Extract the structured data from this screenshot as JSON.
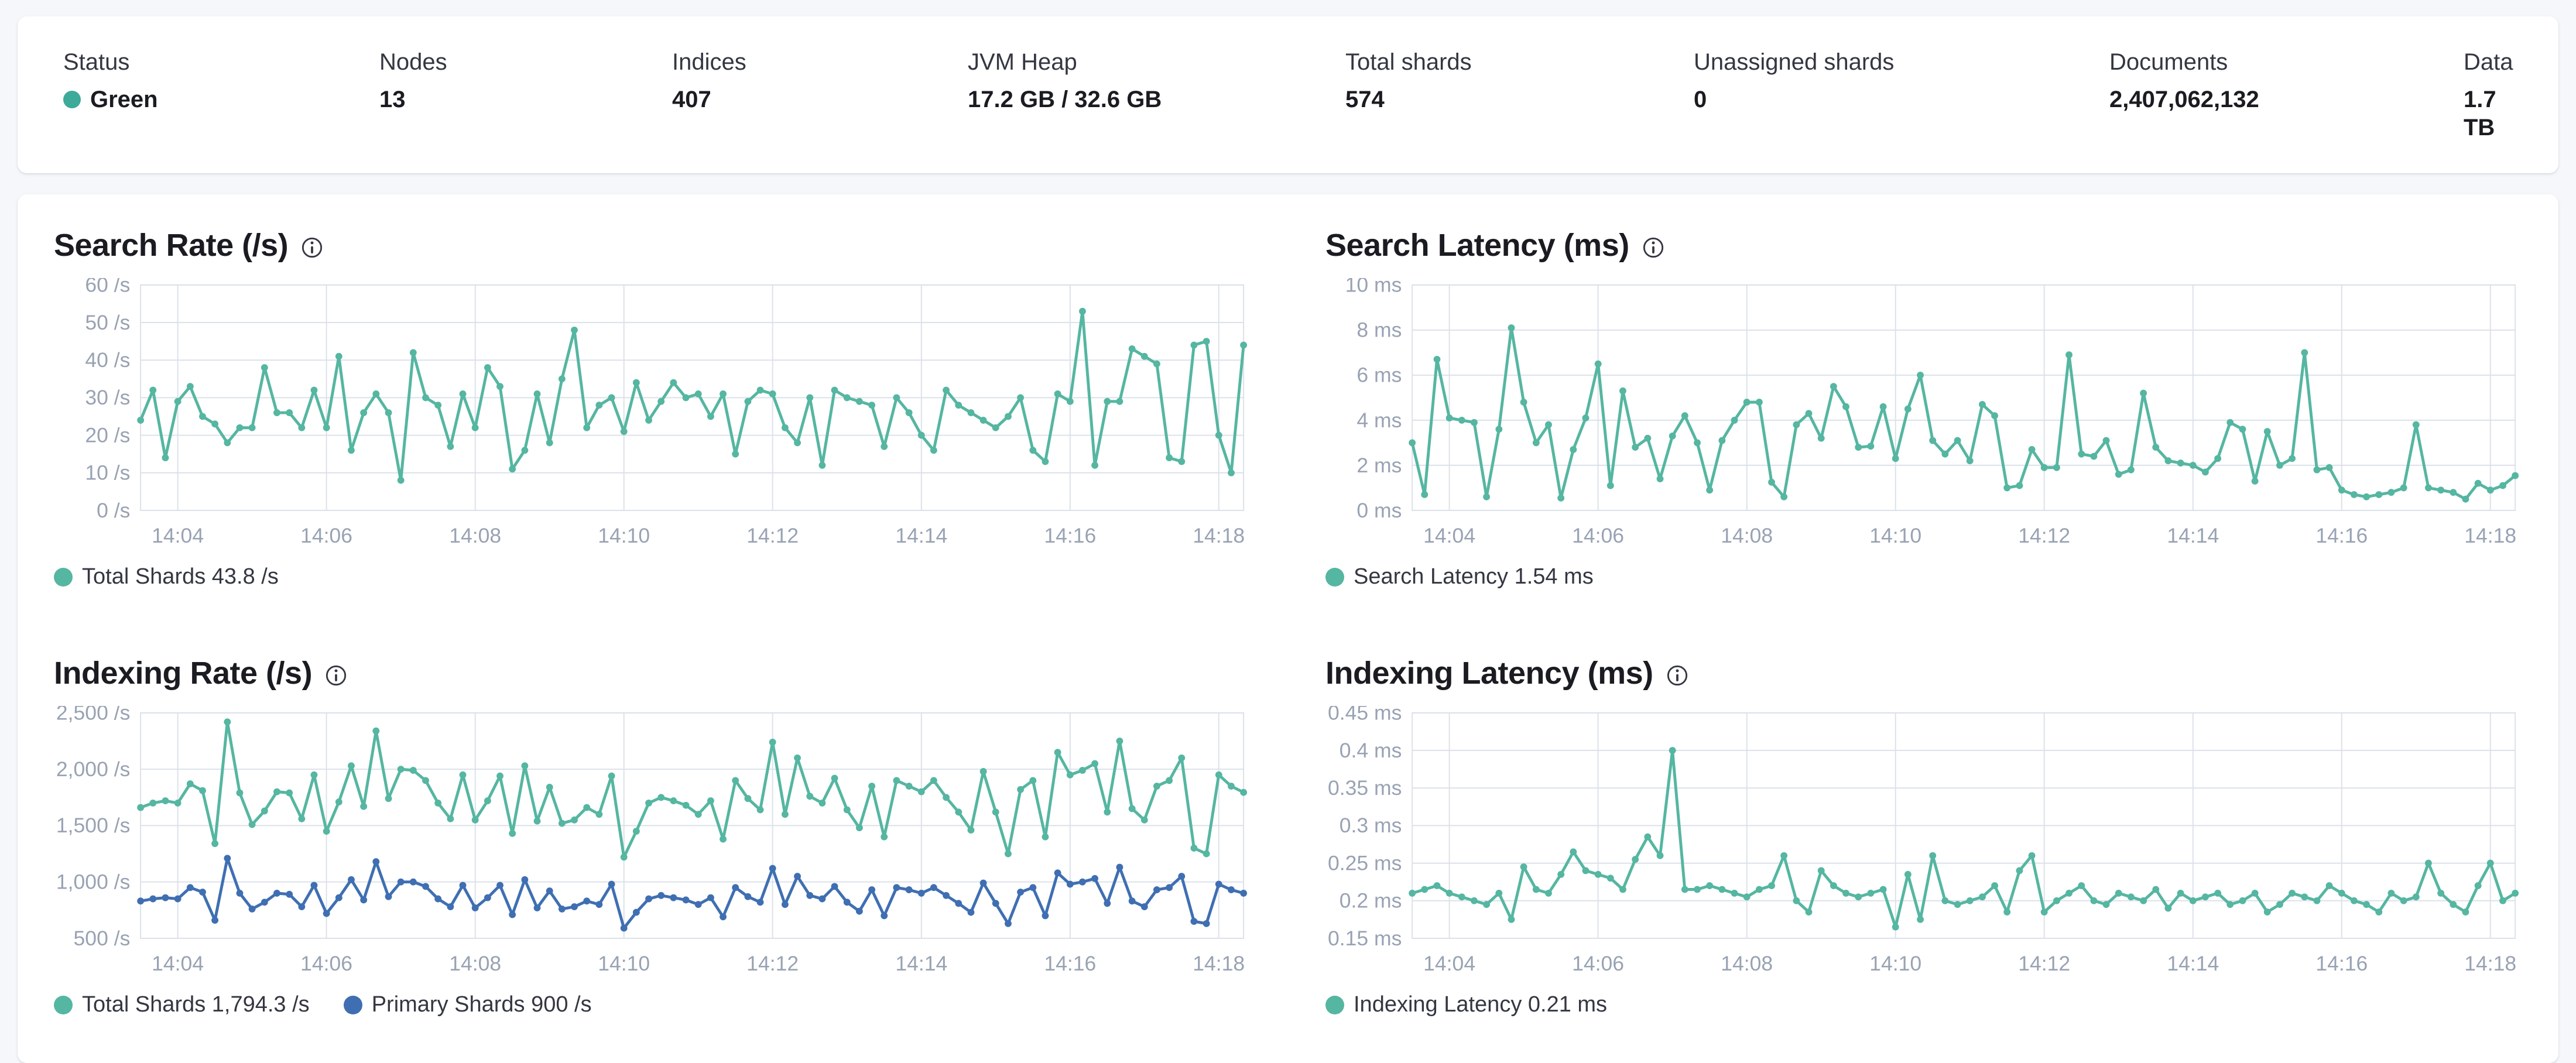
{
  "overview": {
    "status_color": "#3EAA9A",
    "stats": [
      {
        "label": "Status",
        "value": "Green"
      },
      {
        "label": "Nodes",
        "value": "13"
      },
      {
        "label": "Indices",
        "value": "407"
      },
      {
        "label": "JVM Heap",
        "value": "17.2 GB / 32.6 GB"
      },
      {
        "label": "Total shards",
        "value": "574"
      },
      {
        "label": "Unassigned shards",
        "value": "0"
      },
      {
        "label": "Documents",
        "value": "2,407,062,132"
      },
      {
        "label": "Data",
        "value": "1.7 TB"
      }
    ]
  },
  "chart_data": [
    {
      "type": "line",
      "title": "Search Rate (/s)",
      "ylabel": "/s",
      "ylim": [
        0,
        60
      ],
      "grid": true,
      "legend_position": "bottom",
      "yticks": [
        {
          "v": 60,
          "label": "60 /s"
        },
        {
          "v": 50,
          "label": "50 /s"
        },
        {
          "v": 40,
          "label": "40 /s"
        },
        {
          "v": 30,
          "label": "30 /s"
        },
        {
          "v": 20,
          "label": "20 /s"
        },
        {
          "v": 10,
          "label": "10 /s"
        },
        {
          "v": 0,
          "label": "0 /s"
        }
      ],
      "xticks": [
        {
          "f": 0.0337,
          "label": "14:04"
        },
        {
          "f": 0.1685,
          "label": "14:06"
        },
        {
          "f": 0.3034,
          "label": "14:08"
        },
        {
          "f": 0.4382,
          "label": "14:10"
        },
        {
          "f": 0.573,
          "label": "14:12"
        },
        {
          "f": 0.7079,
          "label": "14:14"
        },
        {
          "f": 0.8427,
          "label": "14:16"
        },
        {
          "f": 0.9775,
          "label": "14:18"
        }
      ],
      "series": [
        {
          "name": "Total Shards",
          "legend": "Total Shards 43.8 /s",
          "color": "#55B6A1",
          "values": [
            24,
            32,
            14,
            29,
            33,
            25,
            23,
            18,
            22,
            22,
            38,
            26,
            26,
            22,
            32,
            22,
            41,
            16,
            26,
            31,
            26,
            8,
            42,
            30,
            28,
            17,
            31,
            22,
            38,
            33,
            11,
            16,
            31,
            18,
            35,
            48,
            22,
            28,
            30,
            21,
            34,
            24,
            29,
            34,
            30,
            31,
            25,
            31,
            15,
            29,
            32,
            31,
            22,
            18,
            30,
            12,
            32,
            30,
            29,
            28,
            17,
            30,
            26,
            20,
            16,
            32,
            28,
            26,
            24,
            22,
            25,
            30,
            16,
            13,
            31,
            29,
            53,
            12,
            29,
            29,
            43,
            41,
            39,
            14,
            13,
            44,
            45,
            20,
            10,
            44
          ]
        }
      ]
    },
    {
      "type": "line",
      "title": "Search Latency (ms)",
      "ylabel": "ms",
      "ylim": [
        0,
        10
      ],
      "grid": true,
      "legend_position": "bottom",
      "yticks": [
        {
          "v": 10,
          "label": "10 ms"
        },
        {
          "v": 8,
          "label": "8 ms"
        },
        {
          "v": 6,
          "label": "6 ms"
        },
        {
          "v": 4,
          "label": "4 ms"
        },
        {
          "v": 2,
          "label": "2 ms"
        },
        {
          "v": 0,
          "label": "0 ms"
        }
      ],
      "xticks": [
        {
          "f": 0.0337,
          "label": "14:04"
        },
        {
          "f": 0.1685,
          "label": "14:06"
        },
        {
          "f": 0.3034,
          "label": "14:08"
        },
        {
          "f": 0.4382,
          "label": "14:10"
        },
        {
          "f": 0.573,
          "label": "14:12"
        },
        {
          "f": 0.7079,
          "label": "14:14"
        },
        {
          "f": 0.8427,
          "label": "14:16"
        },
        {
          "f": 0.9775,
          "label": "14:18"
        }
      ],
      "series": [
        {
          "name": "Search Latency",
          "legend": "Search Latency 1.54 ms",
          "color": "#55B6A1",
          "values": [
            3.0,
            0.7,
            6.7,
            4.1,
            4.0,
            3.9,
            0.6,
            3.6,
            8.1,
            4.8,
            3.0,
            3.8,
            0.55,
            2.7,
            4.1,
            6.5,
            1.1,
            5.3,
            2.8,
            3.2,
            1.4,
            3.3,
            4.2,
            3.0,
            0.9,
            3.1,
            4.0,
            4.8,
            4.8,
            1.25,
            0.6,
            3.8,
            4.3,
            3.2,
            5.5,
            4.6,
            2.8,
            2.85,
            4.6,
            2.3,
            4.5,
            6.0,
            3.1,
            2.5,
            3.1,
            2.2,
            4.7,
            4.2,
            1.0,
            1.1,
            2.7,
            1.9,
            1.9,
            6.9,
            2.5,
            2.4,
            3.1,
            1.6,
            1.8,
            5.2,
            2.8,
            2.2,
            2.1,
            2.0,
            1.7,
            2.3,
            3.9,
            3.6,
            1.3,
            3.5,
            2.0,
            2.3,
            7.0,
            1.8,
            1.9,
            0.9,
            0.7,
            0.6,
            0.7,
            0.8,
            1.0,
            3.8,
            1.0,
            0.9,
            0.8,
            0.5,
            1.2,
            0.9,
            1.1,
            1.54
          ]
        }
      ]
    },
    {
      "type": "line",
      "title": "Indexing Rate (/s)",
      "ylabel": "/s",
      "ylim": [
        500,
        2500
      ],
      "grid": true,
      "legend_position": "bottom",
      "yticks": [
        {
          "v": 2500,
          "label": "2,500 /s"
        },
        {
          "v": 2000,
          "label": "2,000 /s"
        },
        {
          "v": 1500,
          "label": "1,500 /s"
        },
        {
          "v": 1000,
          "label": "1,000 /s"
        },
        {
          "v": 500,
          "label": "500 /s"
        }
      ],
      "xticks": [
        {
          "f": 0.0337,
          "label": "14:04"
        },
        {
          "f": 0.1685,
          "label": "14:06"
        },
        {
          "f": 0.3034,
          "label": "14:08"
        },
        {
          "f": 0.4382,
          "label": "14:10"
        },
        {
          "f": 0.573,
          "label": "14:12"
        },
        {
          "f": 0.7079,
          "label": "14:14"
        },
        {
          "f": 0.8427,
          "label": "14:16"
        },
        {
          "f": 0.9775,
          "label": "14:18"
        }
      ],
      "series": [
        {
          "name": "Total Shards",
          "legend": "Total Shards 1,794.3 /s",
          "color": "#55B6A1",
          "values": [
            1660,
            1700,
            1720,
            1700,
            1870,
            1810,
            1340,
            2420,
            1790,
            1510,
            1630,
            1800,
            1790,
            1560,
            1950,
            1450,
            1710,
            2030,
            1670,
            2340,
            1740,
            2000,
            1990,
            1900,
            1700,
            1560,
            1950,
            1550,
            1720,
            1940,
            1430,
            2030,
            1540,
            1840,
            1520,
            1550,
            1660,
            1600,
            1940,
            1220,
            1450,
            1700,
            1750,
            1720,
            1680,
            1600,
            1720,
            1380,
            1900,
            1740,
            1640,
            2240,
            1600,
            2100,
            1760,
            1700,
            1920,
            1640,
            1480,
            1850,
            1400,
            1900,
            1850,
            1800,
            1900,
            1750,
            1620,
            1460,
            1980,
            1620,
            1250,
            1820,
            1900,
            1400,
            2150,
            1950,
            1990,
            2050,
            1620,
            2250,
            1650,
            1550,
            1850,
            1900,
            2100,
            1300,
            1250,
            1950,
            1850,
            1794.3
          ]
        },
        {
          "name": "Primary Shards",
          "legend": "Primary Shards 900 /s",
          "color": "#3F6FB2",
          "values": [
            830,
            850,
            860,
            850,
            950,
            910,
            660,
            1210,
            900,
            760,
            820,
            900,
            890,
            780,
            970,
            720,
            860,
            1020,
            840,
            1180,
            870,
            1000,
            1000,
            960,
            850,
            780,
            970,
            770,
            860,
            970,
            710,
            1020,
            770,
            920,
            760,
            780,
            830,
            800,
            980,
            590,
            730,
            850,
            880,
            860,
            840,
            800,
            860,
            690,
            950,
            870,
            820,
            1120,
            800,
            1050,
            880,
            850,
            960,
            820,
            740,
            930,
            700,
            950,
            930,
            900,
            950,
            880,
            810,
            730,
            990,
            810,
            630,
            910,
            950,
            700,
            1080,
            980,
            1000,
            1030,
            810,
            1130,
            830,
            780,
            930,
            950,
            1050,
            650,
            630,
            980,
            930,
            900
          ]
        }
      ]
    },
    {
      "type": "line",
      "title": "Indexing Latency (ms)",
      "ylabel": "ms",
      "ylim": [
        0.15,
        0.45
      ],
      "grid": true,
      "legend_position": "bottom",
      "yticks": [
        {
          "v": 0.45,
          "label": "0.45 ms"
        },
        {
          "v": 0.4,
          "label": "0.4 ms"
        },
        {
          "v": 0.35,
          "label": "0.35 ms"
        },
        {
          "v": 0.3,
          "label": "0.3 ms"
        },
        {
          "v": 0.25,
          "label": "0.25 ms"
        },
        {
          "v": 0.2,
          "label": "0.2 ms"
        },
        {
          "v": 0.15,
          "label": "0.15 ms"
        }
      ],
      "xticks": [
        {
          "f": 0.0337,
          "label": "14:04"
        },
        {
          "f": 0.1685,
          "label": "14:06"
        },
        {
          "f": 0.3034,
          "label": "14:08"
        },
        {
          "f": 0.4382,
          "label": "14:10"
        },
        {
          "f": 0.573,
          "label": "14:12"
        },
        {
          "f": 0.7079,
          "label": "14:14"
        },
        {
          "f": 0.8427,
          "label": "14:16"
        },
        {
          "f": 0.9775,
          "label": "14:18"
        }
      ],
      "series": [
        {
          "name": "Indexing Latency",
          "legend": "Indexing Latency 0.21 ms",
          "color": "#55B6A1",
          "values": [
            0.21,
            0.215,
            0.22,
            0.21,
            0.205,
            0.2,
            0.195,
            0.21,
            0.175,
            0.245,
            0.215,
            0.21,
            0.235,
            0.265,
            0.24,
            0.235,
            0.23,
            0.215,
            0.255,
            0.285,
            0.26,
            0.4,
            0.215,
            0.215,
            0.22,
            0.215,
            0.21,
            0.205,
            0.215,
            0.22,
            0.26,
            0.2,
            0.185,
            0.24,
            0.22,
            0.21,
            0.205,
            0.21,
            0.215,
            0.165,
            0.235,
            0.175,
            0.26,
            0.2,
            0.195,
            0.2,
            0.205,
            0.22,
            0.185,
            0.24,
            0.26,
            0.185,
            0.2,
            0.21,
            0.22,
            0.2,
            0.195,
            0.21,
            0.205,
            0.2,
            0.215,
            0.19,
            0.21,
            0.2,
            0.205,
            0.21,
            0.195,
            0.2,
            0.21,
            0.185,
            0.195,
            0.21,
            0.205,
            0.2,
            0.22,
            0.21,
            0.2,
            0.195,
            0.185,
            0.21,
            0.2,
            0.205,
            0.25,
            0.21,
            0.195,
            0.185,
            0.22,
            0.25,
            0.2,
            0.21
          ]
        }
      ]
    }
  ]
}
